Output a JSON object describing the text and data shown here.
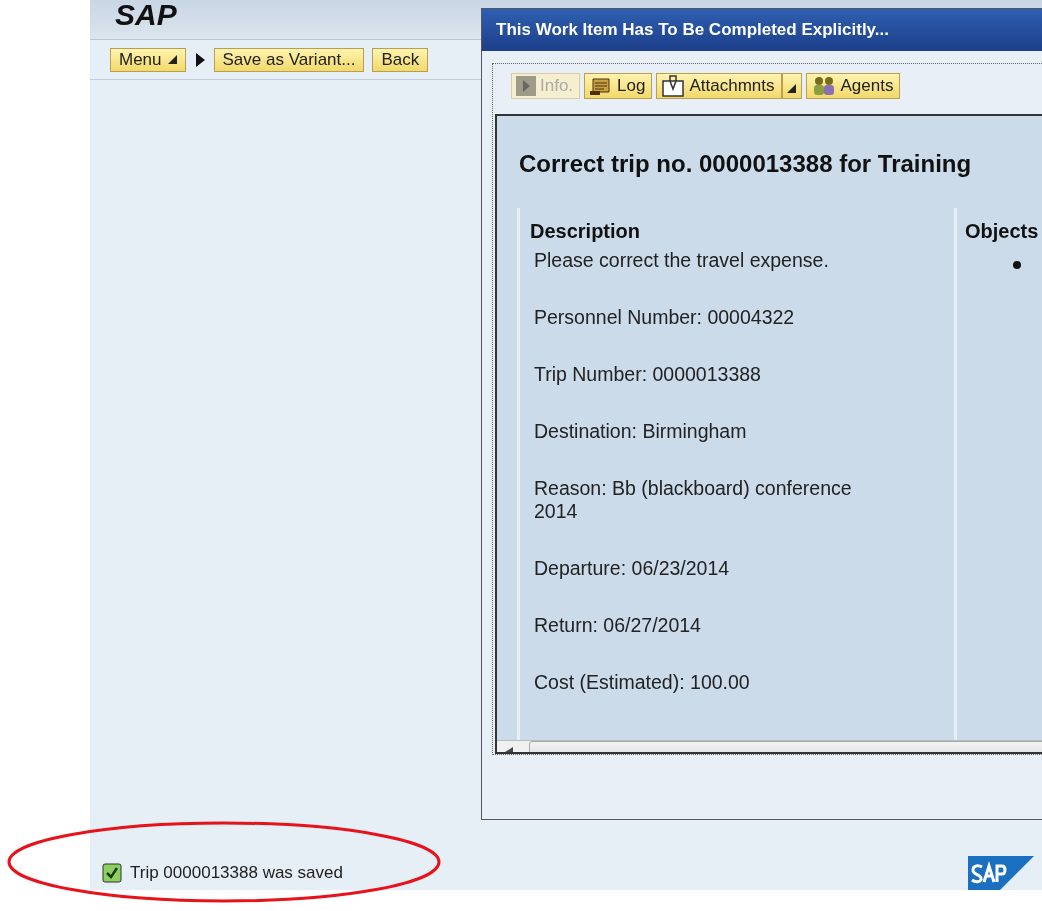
{
  "app": {
    "brand": "SAP"
  },
  "toolbar": {
    "buttons": [
      {
        "label": "Menu",
        "kind": "dropdown"
      },
      {
        "label": "Save as Variant...",
        "kind": "plain"
      },
      {
        "label": "Back",
        "kind": "plain"
      }
    ]
  },
  "dialog": {
    "title": "This Work Item Has To Be Completed Explicitly...",
    "toolbar": [
      {
        "label": "Info.",
        "kind": "play",
        "disabled": true
      },
      {
        "label": "Log",
        "kind": "log",
        "disabled": false
      },
      {
        "label": "Attachmnts",
        "kind": "attach",
        "disabled": false,
        "dropdown": true
      },
      {
        "label": "Agents",
        "kind": "agents",
        "disabled": false
      }
    ],
    "heading": "Correct trip no. 0000013388 for Training",
    "description": {
      "title": "Description",
      "lines": [
        "Please correct the travel expense.",
        "Personnel Number: 00004322",
        "Trip Number: 0000013388",
        "Destination: Birmingham",
        "Reason: Bb (blackboard) conference 2014",
        "Departure: 06/23/2014",
        "Return: 06/27/2014",
        "Cost (Estimated): 100.00"
      ]
    },
    "objects": {
      "title": "Objects"
    }
  },
  "status_bar": {
    "message": "Trip 0000013388 was saved",
    "highlighted": true
  }
}
